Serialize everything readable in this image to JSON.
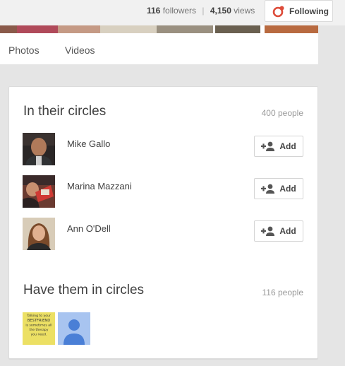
{
  "header": {
    "followers_count": "116",
    "followers_label": "followers",
    "separator": "|",
    "views_count": "4,150",
    "views_label": "views",
    "following_label": "Following",
    "following_icon": "circles-icon",
    "accent_color": "#dd4b39"
  },
  "tabs": [
    {
      "label": "Photos"
    },
    {
      "label": "Videos"
    }
  ],
  "in_their_circles": {
    "title": "In their circles",
    "count": "400 people",
    "people": [
      {
        "name": "Mike Gallo",
        "button": "Add"
      },
      {
        "name": "Marina Mazzani",
        "button": "Add"
      },
      {
        "name": "Ann O'Dell",
        "button": "Add"
      }
    ]
  },
  "have_them_in_circles": {
    "title": "Have them in circles",
    "count": "116 people",
    "thumbnails": [
      {
        "kind": "sticky-note",
        "text": "Talking to your BESTFRIEND is sometimes all the therapy you need."
      },
      {
        "kind": "default-avatar"
      }
    ]
  }
}
